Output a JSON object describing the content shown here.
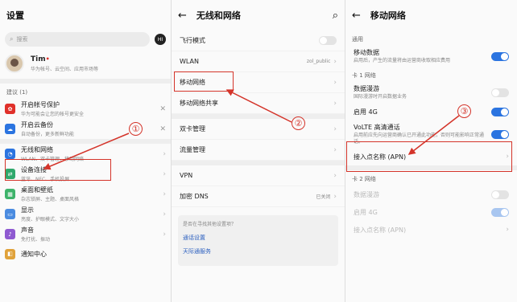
{
  "panel1": {
    "title": "设置",
    "search_placeholder": "搜索",
    "brand_badge": "HI",
    "profile": {
      "name": "Tim",
      "subtitle": "华为帐号、云空间、应用市场等"
    },
    "section_title": "建议 (1)",
    "suggestions": [
      {
        "title": "开启帐号保护",
        "subtitle": "华为可能会让您的帐号更安全",
        "icon": "huawei-icon",
        "color": "#e0302a"
      },
      {
        "title": "开启云备份",
        "subtitle": "自动备份，更多新鲜功能",
        "icon": "cloud-icon",
        "color": "#2b74e0"
      }
    ],
    "items": [
      {
        "title": "无线和网络",
        "subtitle": "WLAN、双卡管理、移动网络",
        "icon": "wifi-icon",
        "color": "#2b74e0"
      },
      {
        "title": "设备连接",
        "subtitle": "蓝牙、NFC、手机投屏",
        "icon": "device-link-icon",
        "color": "#2fa86c"
      },
      {
        "title": "桌面和壁纸",
        "subtitle": "杂志锁屏、主题、桌面风格",
        "icon": "wallpaper-icon",
        "color": "#3db36a"
      },
      {
        "title": "显示",
        "subtitle": "亮度、护眼模式、文字大小",
        "icon": "display-icon",
        "color": "#4a8be0"
      },
      {
        "title": "声音",
        "subtitle": "免打扰、振动",
        "icon": "sound-icon",
        "color": "#8f5ad1"
      },
      {
        "title": "通知中心",
        "subtitle": "",
        "icon": "notification-icon",
        "color": "#e0a23a"
      }
    ]
  },
  "panel2": {
    "title": "无线和网络",
    "airplane": "飞行模式",
    "wlan": {
      "label": "WLAN",
      "value": "zol_public"
    },
    "mobile_network": "移动网络",
    "mobile_share": "移动网络共享",
    "dual_sim": "双卡管理",
    "data_mgmt": "流量管理",
    "vpn": "VPN",
    "private_dns": {
      "label": "加密 DNS",
      "value": "已关闭"
    },
    "card": {
      "question": "是否在寻找其他设置项？",
      "link1": "通话设置",
      "link2": "天际通服务"
    }
  },
  "panel3": {
    "title": "移动网络",
    "general": "通用",
    "mobile_data": {
      "title": "移动数据",
      "subtitle": "启用后，产生的流量将由运营商收取相应费用"
    },
    "sim1_header": "卡 1 网络",
    "roaming": {
      "title": "数据漫游",
      "subtitle": "国际漫游时开启数据业务"
    },
    "lte": "启用 4G",
    "volte": {
      "title": "VoLTE 高清通话",
      "subtitle": "启用前应先向运营商确认已开通此功能，否则可能影响正常通话。"
    },
    "apn": "接入点名称 (APN)",
    "sim2_header": "卡 2 网络",
    "roaming2": "数据漫游",
    "lte2": "启用 4G",
    "apn2": "接入点名称 (APN)"
  },
  "annotations": {
    "n1": "①",
    "n2": "②",
    "n3": "③"
  },
  "colors": {
    "accent": "#2b74e0",
    "annotation": "#d4342a"
  }
}
